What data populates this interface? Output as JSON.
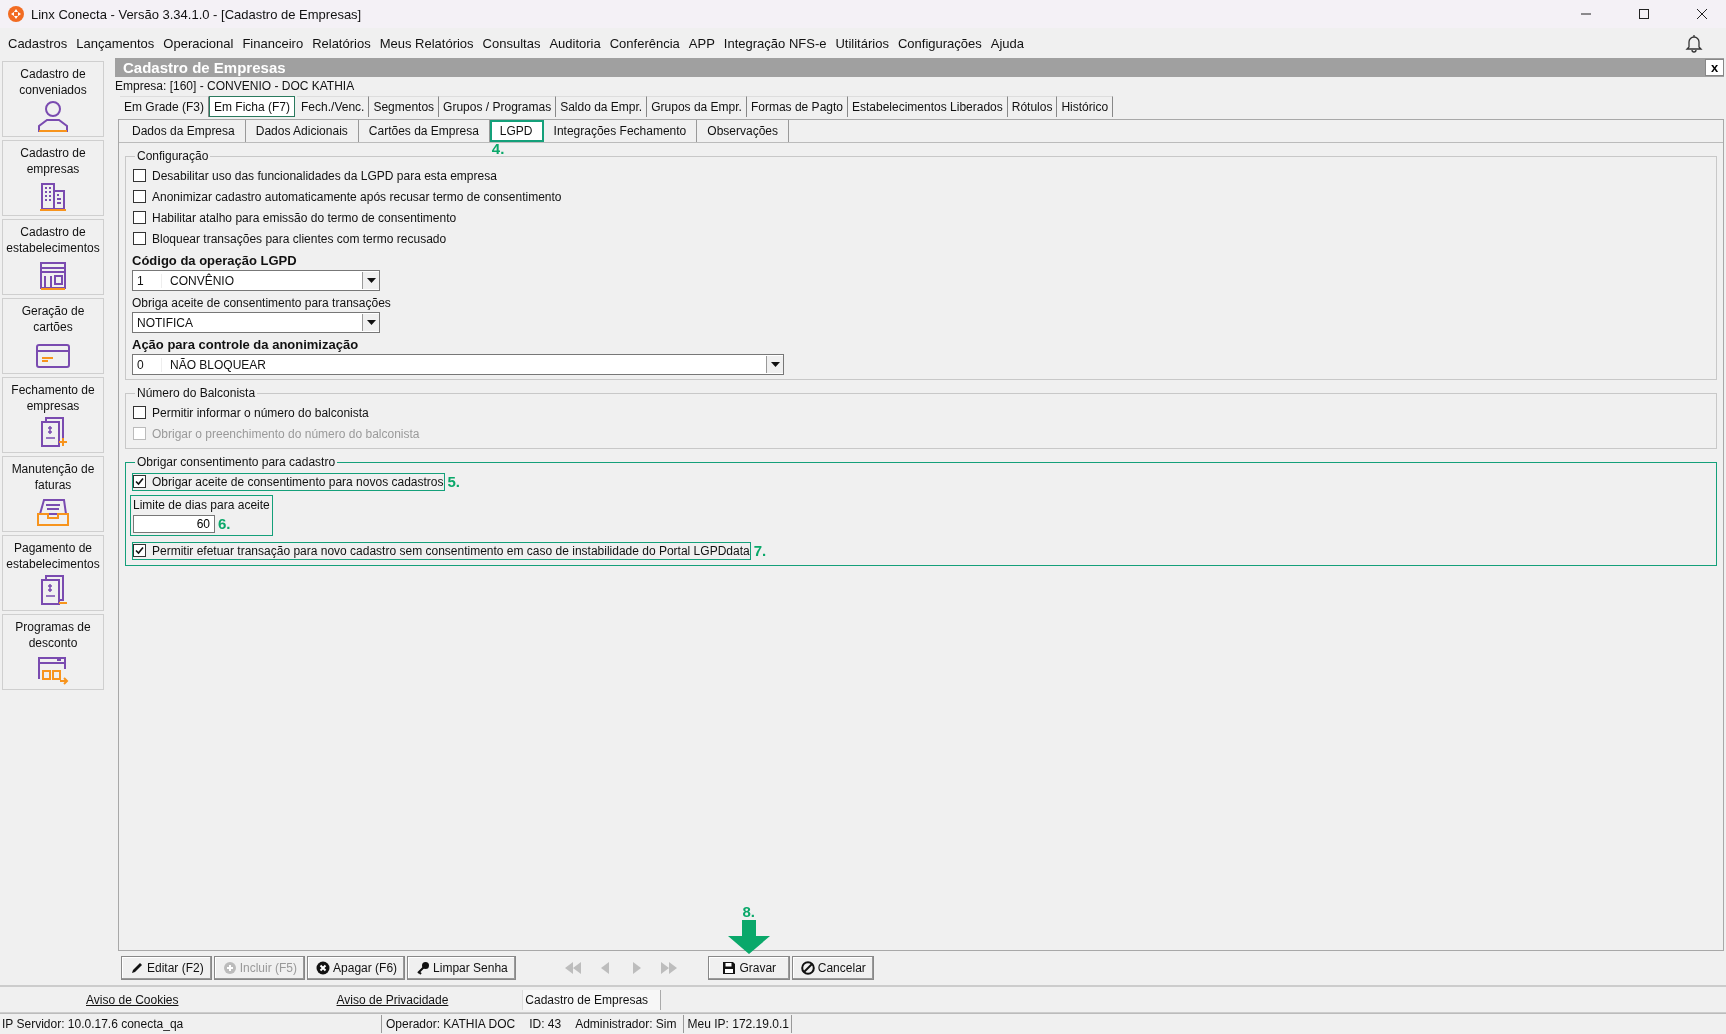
{
  "window": {
    "title": "Linx Conecta - Versão 3.34.1.0 - [Cadastro de Empresas]"
  },
  "menu": [
    "Cadastros",
    "Lançamentos",
    "Operacional",
    "Financeiro",
    "Relatórios",
    "Meus Relatórios",
    "Consultas",
    "Auditoria",
    "Conferência",
    "APP",
    "Integração NFS-e",
    "Utilitários",
    "Configurações",
    "Ajuda"
  ],
  "sidebar": [
    {
      "label": "Cadastro de conveniados",
      "kind": "person"
    },
    {
      "label": "Cadastro de empresas",
      "kind": "building"
    },
    {
      "label": "Cadastro de estabelecimentos",
      "kind": "store"
    },
    {
      "label": "Geração de cartões",
      "kind": "card"
    },
    {
      "label": "Fechamento de empresas",
      "kind": "invoice-add"
    },
    {
      "label": "Manutenção de faturas",
      "kind": "tray"
    },
    {
      "label": "Pagamento de estabelecimentos",
      "kind": "invoice-pay"
    },
    {
      "label": "Programas de desconto",
      "kind": "discount"
    }
  ],
  "panel": {
    "title": "Cadastro de Empresas",
    "close": "x",
    "company": "Empresa: [160] - CONVENIO -  DOC KATHIA"
  },
  "tabs": [
    {
      "label": "Em Grade (F3)",
      "selected": false
    },
    {
      "label": "Em Ficha (F7)",
      "selected": true
    },
    {
      "label": "Fech./Venc.",
      "selected": false
    },
    {
      "label": "Segmentos",
      "selected": false
    },
    {
      "label": "Grupos / Programas",
      "selected": false
    },
    {
      "label": "Saldo da Empr.",
      "selected": false
    },
    {
      "label": "Grupos da Empr.",
      "selected": false
    },
    {
      "label": "Formas de Pagto",
      "selected": false
    },
    {
      "label": "Estabelecimentos Liberados",
      "selected": false
    },
    {
      "label": "Rótulos",
      "selected": false
    },
    {
      "label": "Histórico",
      "selected": false
    }
  ],
  "subtabs": [
    {
      "label": "Dados da Empresa",
      "selected": false,
      "highlighted": false
    },
    {
      "label": "Dados Adicionais",
      "selected": false,
      "highlighted": false
    },
    {
      "label": "Cartões da Empresa",
      "selected": false,
      "highlighted": false
    },
    {
      "label": "LGPD",
      "selected": true,
      "highlighted": true,
      "marker": "4."
    },
    {
      "label": "Integrações Fechamento",
      "selected": false,
      "highlighted": false
    },
    {
      "label": "Observações",
      "selected": false,
      "highlighted": false
    }
  ],
  "sections": [
    {
      "legend": "Configuração",
      "highlighted": false,
      "items": [
        {
          "kind": "checkbox",
          "label": "Desabilitar uso das funcionalidades da LGPD para esta empresa",
          "checked": false,
          "disabled": false,
          "highlighted": false
        },
        {
          "kind": "checkbox",
          "label": "Anonimizar cadastro automaticamente após recusar termo de consentimento",
          "checked": false,
          "disabled": false,
          "highlighted": false
        },
        {
          "kind": "checkbox",
          "label": "Habilitar atalho para emissão do termo de consentimento",
          "checked": false,
          "disabled": false,
          "highlighted": false
        },
        {
          "kind": "checkbox",
          "label": "Bloquear transações para clientes com termo recusado",
          "checked": false,
          "disabled": false,
          "highlighted": false
        },
        {
          "kind": "select",
          "label": "Código da operação LGPD",
          "bold": true,
          "code": "1",
          "value": "CONVÊNIO"
        },
        {
          "kind": "select",
          "label": "Obriga aceite de consentimento para transações",
          "bold": false,
          "value": "NOTIFICA"
        },
        {
          "kind": "wide-select",
          "label": "Ação para controle da anonimização",
          "bold": true,
          "code": "0",
          "value": "NÃO BLOQUEAR"
        }
      ]
    },
    {
      "legend": "Número do Balconista",
      "highlighted": false,
      "items": [
        {
          "kind": "checkbox",
          "label": "Permitir informar o número do balconista",
          "checked": false,
          "disabled": false,
          "highlighted": false
        },
        {
          "kind": "checkbox",
          "label": "Obrigar o preenchimento do número do balconista",
          "checked": false,
          "disabled": true,
          "highlighted": false
        }
      ]
    },
    {
      "legend": "Obrigar consentimento para cadastro",
      "highlighted": true,
      "items": [
        {
          "kind": "checkbox",
          "label": "Obrigar aceite de consentimento para novos cadastros",
          "checked": true,
          "disabled": false,
          "highlighted": true,
          "marker": "5."
        },
        {
          "kind": "number",
          "label": "Limite de dias para aceite",
          "value": "60",
          "highlighted": true,
          "marker": "6."
        },
        {
          "kind": "checkbox",
          "label": "Permitir efetuar transação para novo cadastro sem consentimento em caso de instabilidade do Portal LGPDdata",
          "checked": true,
          "disabled": false,
          "highlighted": true,
          "marker": "7."
        }
      ]
    }
  ],
  "toolbar": [
    {
      "label": "Editar (F2)",
      "kind": "pencil",
      "disabled": false
    },
    {
      "label": "Incluir (F5)",
      "kind": "plus",
      "disabled": true
    },
    {
      "label": "Apagar (F6)",
      "kind": "delete",
      "disabled": false
    },
    {
      "label": "Limpar Senha",
      "kind": "key",
      "disabled": false
    }
  ],
  "navigation": [
    {
      "kind": "first",
      "disabled": true
    },
    {
      "kind": "prev",
      "disabled": true
    },
    {
      "kind": "next",
      "disabled": true
    },
    {
      "kind": "last",
      "disabled": true
    }
  ],
  "actions": [
    {
      "label": "Gravar",
      "kind": "save",
      "marker": "8."
    },
    {
      "label": "Cancelar",
      "kind": "cancel"
    }
  ],
  "footer": {
    "links": [
      "Aviso de Cookies",
      "Aviso de Privacidade"
    ],
    "tab": "Cadastro de Empresas"
  },
  "status_bar": [
    "IP Servidor: 10.0.17.6 conecta_qa",
    "Operador: KATHIA DOC",
    "ID: 43",
    "Administrador: Sim",
    "Meu IP: 172.19.0.1"
  ]
}
